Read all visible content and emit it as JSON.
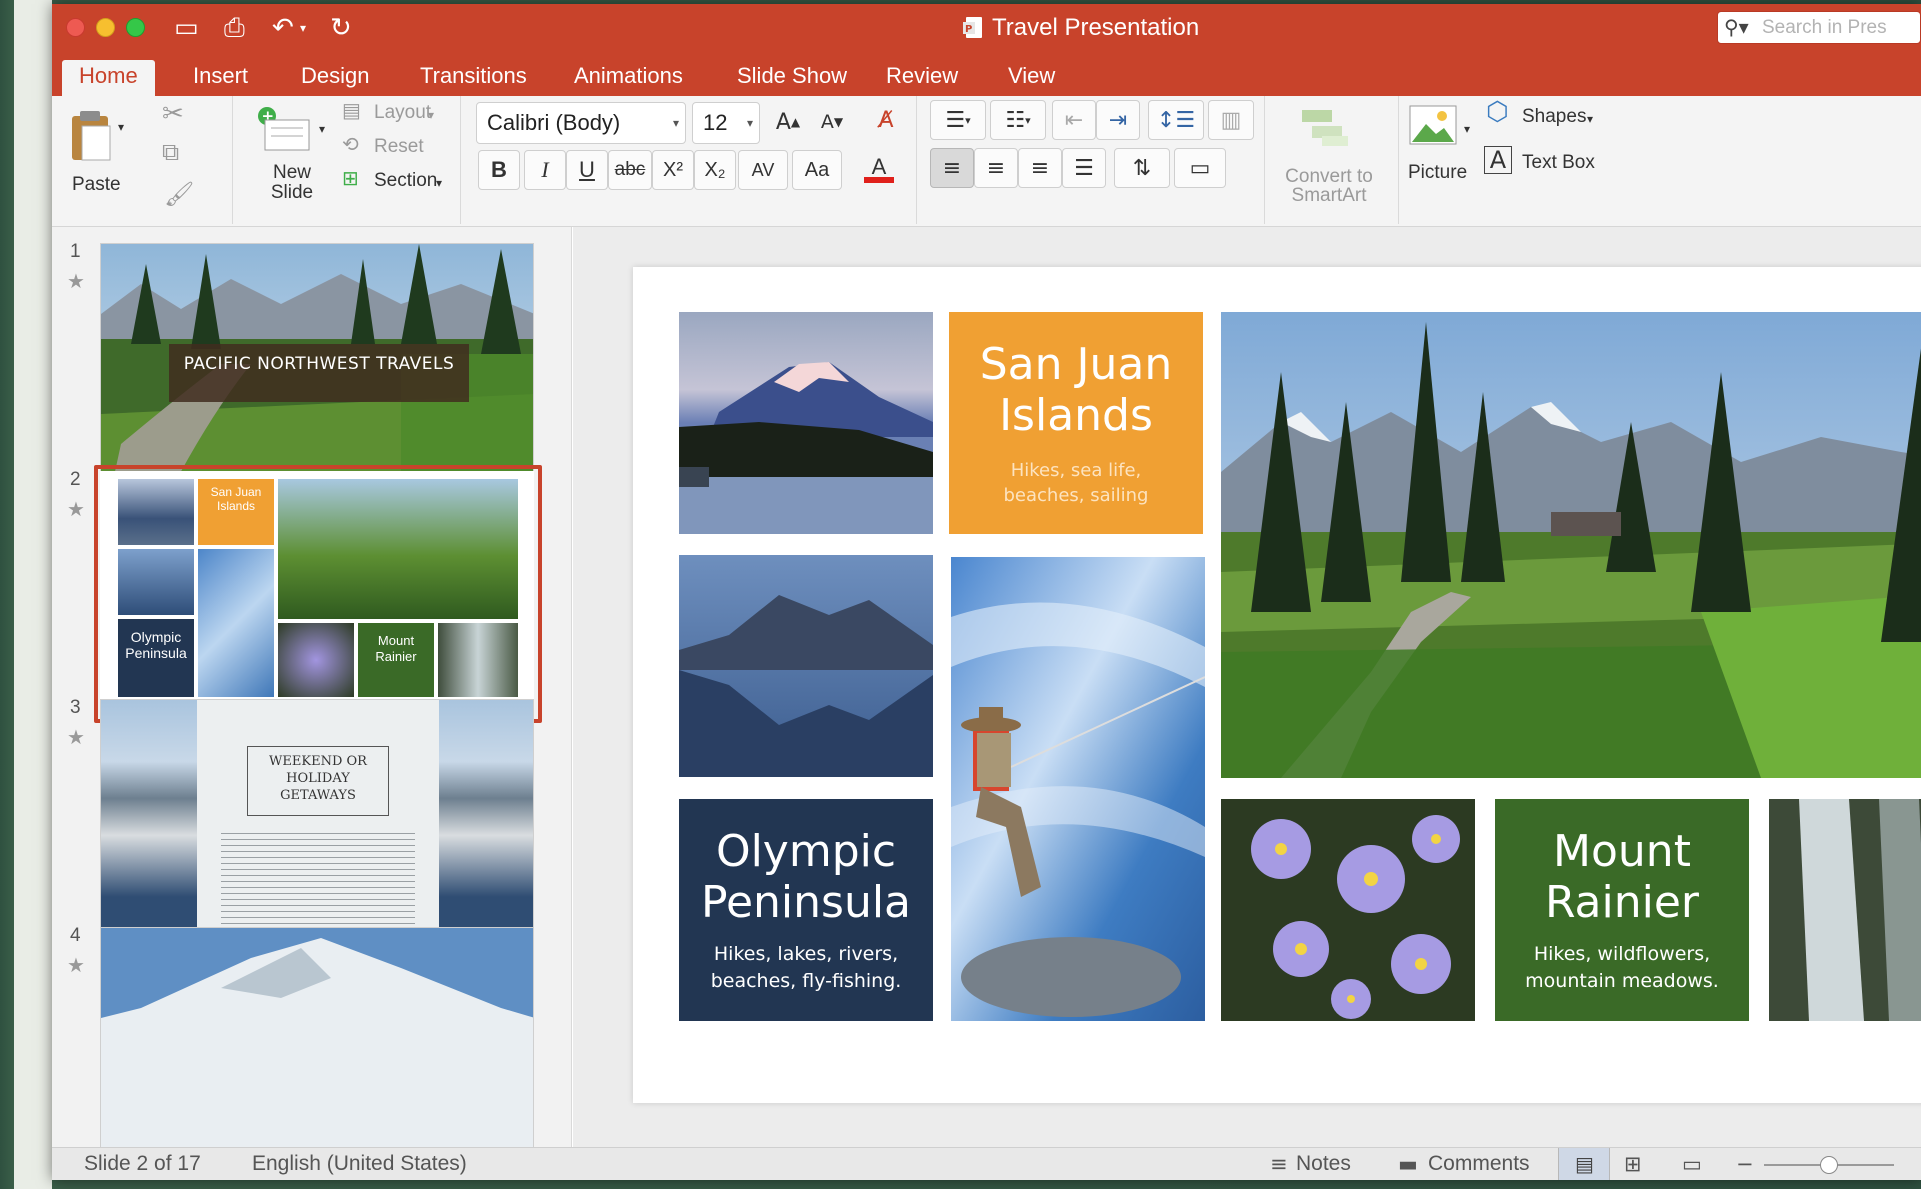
{
  "app": {
    "window_title": "Travel Presentation",
    "search_placeholder": "Search in Pres"
  },
  "tabs": [
    "Home",
    "Insert",
    "Design",
    "Transitions",
    "Animations",
    "Slide Show",
    "Review",
    "View"
  ],
  "ribbon": {
    "paste": "Paste",
    "new_slide": [
      "New",
      "Slide"
    ],
    "layout": "Layout",
    "reset": "Reset",
    "section": "Section",
    "font_name": "Calibri (Body)",
    "font_size": "12",
    "convert_smartart": [
      "Convert to",
      "SmartArt"
    ],
    "picture": "Picture",
    "shapes": "Shapes",
    "text_box": "Text Box",
    "format_buttons": {
      "bold": "B",
      "italic": "I",
      "underline": "U",
      "strike": "abc",
      "superscript": "X²",
      "subscript": "X₂",
      "spacing": "AV",
      "case": "Aa",
      "font_color": "A"
    },
    "font_grow": "A",
    "font_shrink": "A",
    "accent_color": "#c8432b"
  },
  "thumbnails": {
    "numbers": [
      "1",
      "2",
      "3",
      "4"
    ],
    "slide1_title": "PACIFIC NORTHWEST TRAVELS",
    "slide2_tiles": [
      "San Juan Islands",
      "Olympic Peninsula",
      "Mount Rainier"
    ],
    "slide3_title": [
      "WEEKEND OR",
      "HOLIDAY",
      "GETAWAYS"
    ]
  },
  "slide": {
    "san_juan": {
      "title": [
        "San Juan",
        "Islands"
      ],
      "subtitle": [
        "Hikes, sea life,",
        "beaches, sailing"
      ]
    },
    "olympic": {
      "title": [
        "Olympic",
        "Peninsula"
      ],
      "subtitle": [
        "Hikes, lakes, rivers,",
        "beaches, fly-fishing."
      ]
    },
    "rainier": {
      "title": [
        "Mount",
        "Rainier"
      ],
      "subtitle": [
        "Hikes, wildflowers,",
        "mountain meadows."
      ]
    },
    "colors": {
      "orange": "#f0a033",
      "navy": "#223652",
      "green": "#3a6a27"
    }
  },
  "status": {
    "slide_indicator": "Slide 2 of 17",
    "language": "English (United States)",
    "notes": "Notes",
    "comments": "Comments"
  }
}
